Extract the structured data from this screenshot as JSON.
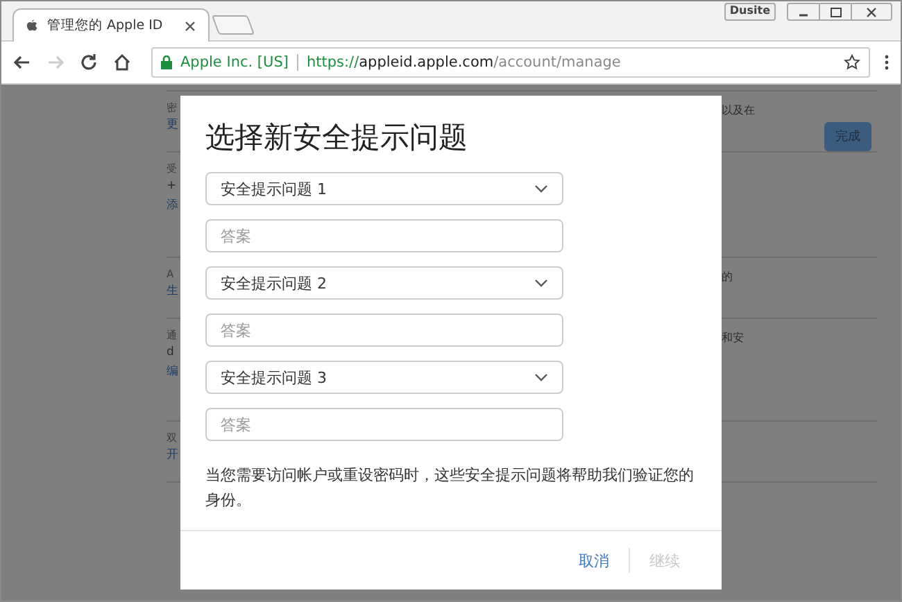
{
  "browser": {
    "tab_title": "管理您的 Apple ID",
    "profile": "Dusite",
    "cert": "Apple Inc. [US]",
    "url_scheme": "https://",
    "url_host": "appleid.apple.com",
    "url_path": "/account/manage",
    "forward_disabled": true
  },
  "page": {
    "done_button": "完成",
    "rows": [
      {
        "left": [
          "密",
          "更"
        ],
        "right": "以及在"
      },
      {
        "left": [
          "受",
          "+",
          "添"
        ],
        "right": ""
      },
      {
        "left": [
          "A",
          "生"
        ],
        "right": "的"
      },
      {
        "left": [
          "通",
          "d",
          "编"
        ],
        "right": "和安"
      },
      {
        "left": [
          "双",
          "开"
        ],
        "right": ""
      }
    ]
  },
  "dialog": {
    "title": "选择新安全提示问题",
    "questions": [
      {
        "select": "安全提示问题 1",
        "answer_placeholder": "答案"
      },
      {
        "select": "安全提示问题 2",
        "answer_placeholder": "答案"
      },
      {
        "select": "安全提示问题 3",
        "answer_placeholder": "答案"
      }
    ],
    "note": "当您需要访问帐户或重设密码时，这些安全提示问题将帮助我们验证您的身份。",
    "buttons": [
      {
        "label": "取消",
        "disabled": false
      },
      {
        "label": "继续",
        "disabled": true
      }
    ]
  }
}
